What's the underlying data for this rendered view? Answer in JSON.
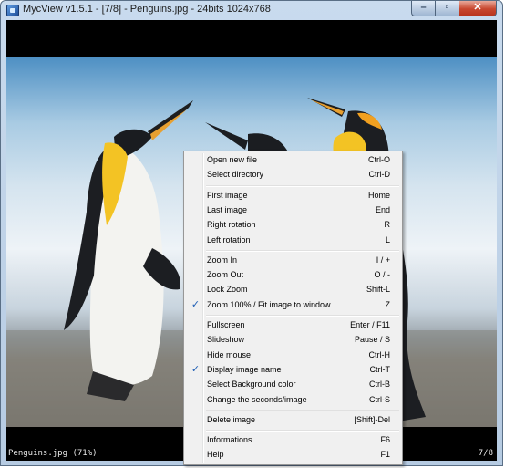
{
  "window": {
    "title": "MycView v1.5.1 - [7/8] - Penguins.jpg - 24bits  1024x768",
    "icon": "mycview-app-icon",
    "caption": {
      "minimize": "–",
      "maximize": "▫",
      "close": "✕"
    }
  },
  "status": {
    "left": "Penguins.jpg (71%)",
    "right": "7/8"
  },
  "menu": {
    "groups": [
      [
        {
          "label": "Open new file",
          "shortcut": "Ctrl-O"
        },
        {
          "label": "Select directory",
          "shortcut": "Ctrl-D"
        }
      ],
      [
        {
          "label": "First image",
          "shortcut": "Home"
        },
        {
          "label": "Last image",
          "shortcut": "End"
        },
        {
          "label": "Right rotation",
          "shortcut": "R"
        },
        {
          "label": "Left rotation",
          "shortcut": "L"
        }
      ],
      [
        {
          "label": "Zoom In",
          "shortcut": "I / +"
        },
        {
          "label": "Zoom Out",
          "shortcut": "O / -"
        },
        {
          "label": "Lock Zoom",
          "shortcut": "Shift-L"
        },
        {
          "label": "Zoom 100% / Fit image to window",
          "shortcut": "Z",
          "checked": true
        }
      ],
      [
        {
          "label": "Fullscreen",
          "shortcut": "Enter / F11"
        },
        {
          "label": "Slideshow",
          "shortcut": "Pause / S"
        },
        {
          "label": "Hide mouse",
          "shortcut": "Ctrl-H"
        },
        {
          "label": "Display image name",
          "shortcut": "Ctrl-T",
          "checked": true
        },
        {
          "label": "Select Background color",
          "shortcut": "Ctrl-B"
        },
        {
          "label": "Change the seconds/image",
          "shortcut": "Ctrl-S"
        }
      ],
      [
        {
          "label": "Delete image",
          "shortcut": "[Shift]-Del"
        }
      ],
      [
        {
          "label": "Informations",
          "shortcut": "F6"
        },
        {
          "label": "Help",
          "shortcut": "F1"
        }
      ]
    ],
    "check_glyph": "✓"
  }
}
